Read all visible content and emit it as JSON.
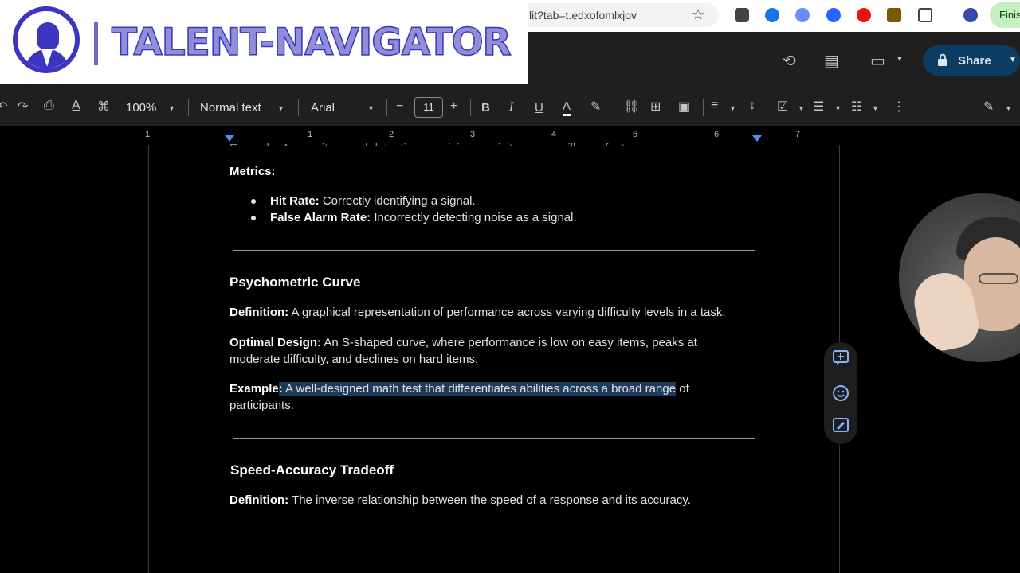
{
  "browser": {
    "url_fragment": "lit?tab=t.edxofomlxjov",
    "finish_label": "Finis"
  },
  "logo": {
    "text": "TALENT-NAVIGATOR"
  },
  "header": {
    "share_label": "Share"
  },
  "toolbar": {
    "zoom": "100%",
    "style": "Normal text",
    "font": "Arial",
    "font_size": "11",
    "minus": "−",
    "plus": "+",
    "bold": "B",
    "italic": "I",
    "underline": "U",
    "text_color": "A"
  },
  "ruler": {
    "numbers": [
      "1",
      "1",
      "2",
      "3",
      "4",
      "5",
      "6",
      "7"
    ]
  },
  "document": {
    "cutoff_line": "Example: A security guard detecting suspicious activity on surveillance footage.",
    "metrics_label": "Metrics:",
    "bullets": [
      {
        "term": "Hit Rate:",
        "text": " Correctly identifying a signal."
      },
      {
        "term": "False Alarm Rate:",
        "text": " Incorrectly detecting noise as a signal."
      }
    ],
    "section1": {
      "heading": "Psychometric Curve",
      "definition_label": "Definition:",
      "definition_text": " A graphical representation of performance across varying difficulty levels in a task.",
      "optimal_label": "Optimal Design:",
      "optimal_text_line1": " An S-shaped curve, where performance is low on easy items, peaks at",
      "optimal_text_line2": "moderate difficulty, and declines on hard items.",
      "example_label": "Example",
      "example_colon": ":",
      "example_highlight": " A well-designed math test that differentiates abilities across a broad range",
      "example_rest": " of",
      "example_line2": "participants."
    },
    "section2": {
      "heading": "Speed-Accuracy Tradeoff",
      "definition_label": "Definition:",
      "definition_text": " The inverse relationship between the speed of a response and its accuracy."
    }
  },
  "side_actions": [
    "add-comment-icon",
    "emoji-reaction-icon",
    "suggest-edit-icon"
  ],
  "colors": {
    "selection_highlight": "#1c3a5c",
    "share_button": "#0b3d63",
    "logo_brand": "#3d34c2"
  }
}
